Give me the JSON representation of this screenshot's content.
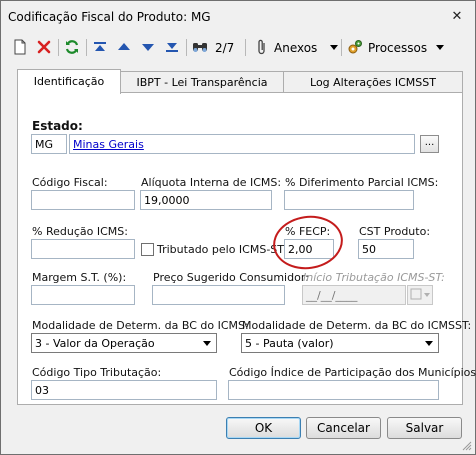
{
  "window": {
    "title": "Codificação Fiscal do Produto: MG",
    "close_glyph": "✕"
  },
  "toolbar": {
    "new_icon": "new-document-icon",
    "delete_icon": "delete-x-icon",
    "refresh_icon": "refresh-icon",
    "record_counter": "2/7",
    "anexos_label": "Anexos",
    "processos_label": "Processos"
  },
  "tabs": [
    {
      "label": "Identificação",
      "active": true
    },
    {
      "label": "IBPT - Lei Transparência",
      "active": false
    },
    {
      "label": "Log Alterações ICMSST",
      "active": false
    }
  ],
  "form": {
    "estado_label": "Estado:",
    "estado_code": "MG",
    "estado_name": "Minas Gerais",
    "estado_browse": "...",
    "codigo_fiscal_label": "Código Fiscal:",
    "codigo_fiscal_value": "",
    "aliquota_label": "Alíquota Interna de ICMS:",
    "aliquota_value": "19,0000",
    "diferimento_label": "% Diferimento Parcial ICMS:",
    "diferimento_value": "",
    "reducao_label": "% Redução ICMS:",
    "reducao_value": "",
    "tributado_label": "Tributado pelo ICMS-ST",
    "fecp_label": "% FECP:",
    "fecp_value": "2,00",
    "cst_label": "CST Produto:",
    "cst_value": "50",
    "margem_label": "Margem S.T. (%):",
    "margem_value": "",
    "preco_label": "Preço Sugerido Consumidor:",
    "preco_value": "",
    "inicio_label": "Início Tributação ICMS-ST:",
    "inicio_value": "__/__/____",
    "modalidade_icms_label": "Modalidade de Determ. da BC do ICMS:",
    "modalidade_icms_value": "3 - Valor da Operação",
    "modalidade_icmsst_label": "Modalidade de Determ. da BC do ICMSST:",
    "modalidade_icmsst_value": "5 - Pauta (valor)",
    "codigo_tipo_label": "Código Tipo Tributação:",
    "codigo_tipo_value": "03",
    "codigo_indice_label": "Código Índice de Participação dos Municípios:",
    "codigo_indice_value": ""
  },
  "buttons": {
    "ok": "OK",
    "cancel": "Cancelar",
    "save": "Salvar"
  },
  "colors": {
    "highlight": "#c41c1c",
    "link": "#0000cc"
  }
}
